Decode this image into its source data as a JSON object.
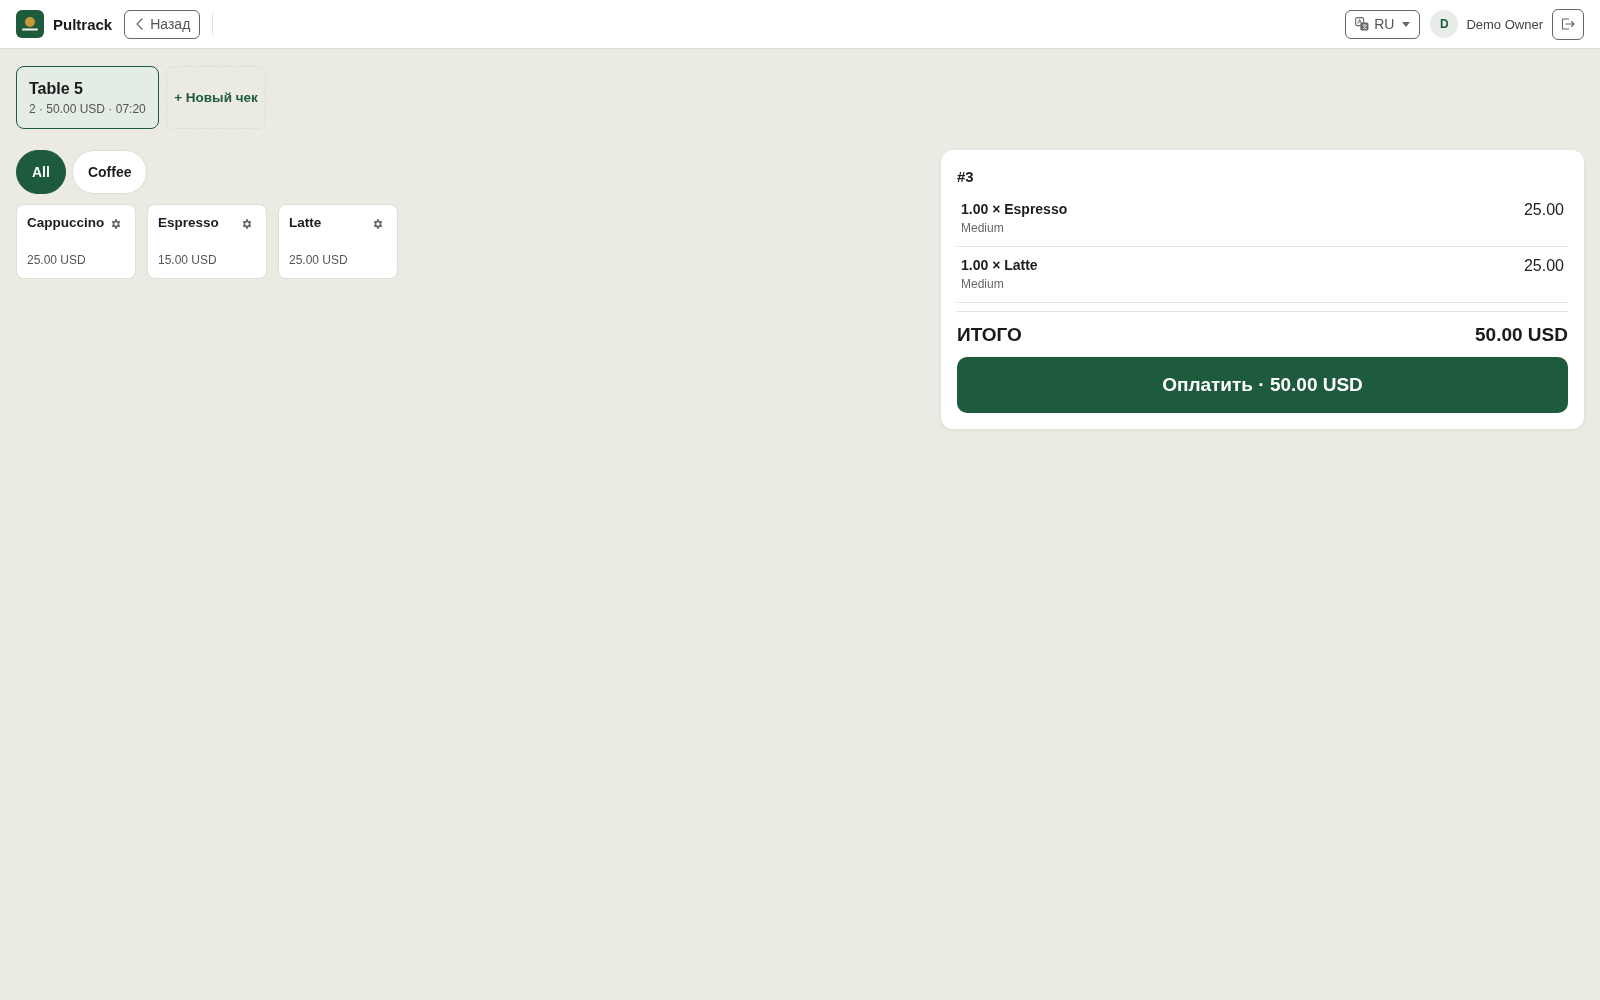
{
  "header": {
    "brand": "Pultrack",
    "back_button": "Назад",
    "language": "RU",
    "user": {
      "initial": "D",
      "name": "Demo Owner"
    }
  },
  "tickets": [
    {
      "title": "Table 5",
      "meta": "2 · 50.00 USD · 07:20",
      "selected": true
    }
  ],
  "new_ticket_button": "+ Новый чек",
  "categories": [
    {
      "label": "All",
      "selected": true
    },
    {
      "label": "Coffee",
      "selected": false
    }
  ],
  "products": [
    {
      "name": "Cappuccino",
      "price": "25.00 USD"
    },
    {
      "name": "Espresso",
      "price": "15.00 USD"
    },
    {
      "name": "Latte",
      "price": "25.00 USD"
    }
  ],
  "order": {
    "title": "#3",
    "lines": [
      {
        "item": "1.00 × Espresso",
        "modifier": "Medium",
        "amount": "25.00"
      },
      {
        "item": "1.00 × Latte",
        "modifier": "Medium",
        "amount": "25.00"
      }
    ],
    "total_label": "ИТОГО",
    "total": "50.00 USD",
    "pay_button": "Оплатить · 50.00 USD"
  }
}
